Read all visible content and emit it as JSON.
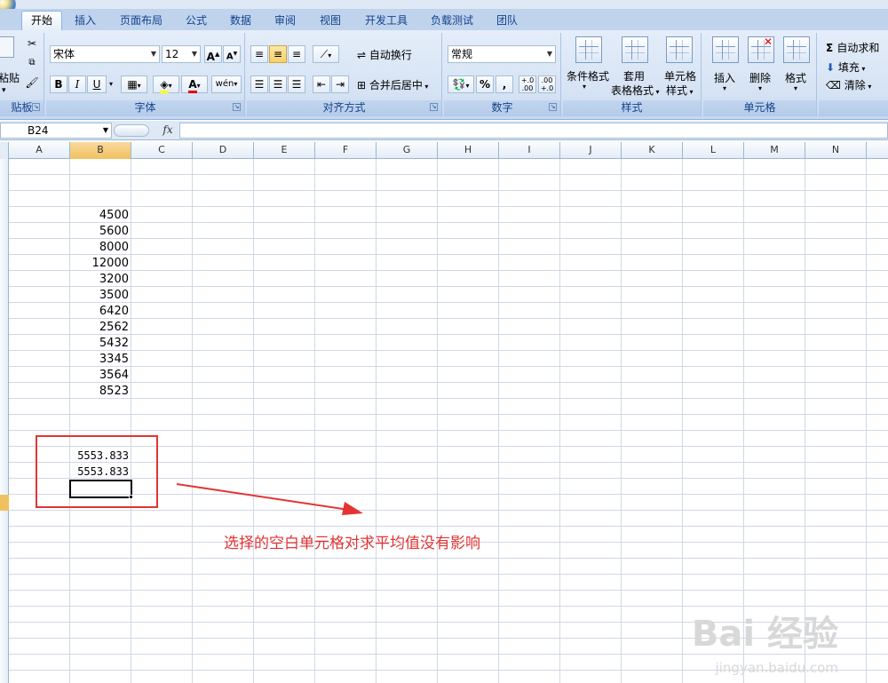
{
  "ribbon_tabs": [
    "开始",
    "插入",
    "页面布局",
    "公式",
    "数据",
    "审阅",
    "视图",
    "开发工具",
    "负载测试",
    "团队"
  ],
  "clipboard": {
    "paste_label": "粘贴",
    "group_label": "贴板"
  },
  "font": {
    "name": "宋体",
    "size": "12",
    "group_label": "字体",
    "bold": "B",
    "italic": "I",
    "underline": "U",
    "grow": "A",
    "shrink": "A",
    "color_glyph": "A",
    "phonetic": "wén"
  },
  "alignment": {
    "wrap_label": "自动换行",
    "merge_label": "合并后居中",
    "group_label": "对齐方式"
  },
  "number": {
    "format": "常规",
    "percent": "%",
    "comma": ",",
    "inc_decimal": "+.0\n.00",
    "dec_decimal": ".00\n+.0",
    "group_label": "数字"
  },
  "styles": {
    "conditional_label": "条件格式",
    "table_format_label_1": "套用",
    "table_format_label_2": "表格格式",
    "cell_style_label_1": "单元格",
    "cell_style_label_2": "样式",
    "group_label": "样式"
  },
  "cells": {
    "insert_label": "插入",
    "delete_label": "删除",
    "format_label": "格式",
    "group_label": "单元格"
  },
  "editing": {
    "autosum_label": "自动求和",
    "fill_label": "填充",
    "clear_label": "清除"
  },
  "formula_bar": {
    "name_box": "B24",
    "fx": "fx",
    "formula": ""
  },
  "columns": [
    "A",
    "B",
    "C",
    "D",
    "E",
    "F",
    "G",
    "H",
    "I",
    "J",
    "K",
    "L",
    "M",
    "N"
  ],
  "selected_column": "B",
  "sheet": {
    "values": [
      "4500",
      "5600",
      "8000",
      "12000",
      "3200",
      "3500",
      "6420",
      "2562",
      "5432",
      "3345",
      "3564",
      "8523"
    ],
    "averages": [
      "5553.833",
      "5553.833"
    ]
  },
  "annotation": "选择的空白单元格对求平均值没有影响",
  "colors": {
    "annotation": "#e23434",
    "accent": "#15428b",
    "selection": "#f1c15f"
  },
  "watermark": {
    "brand": "Bai 经验",
    "url": "jingyan.baidu.com"
  }
}
